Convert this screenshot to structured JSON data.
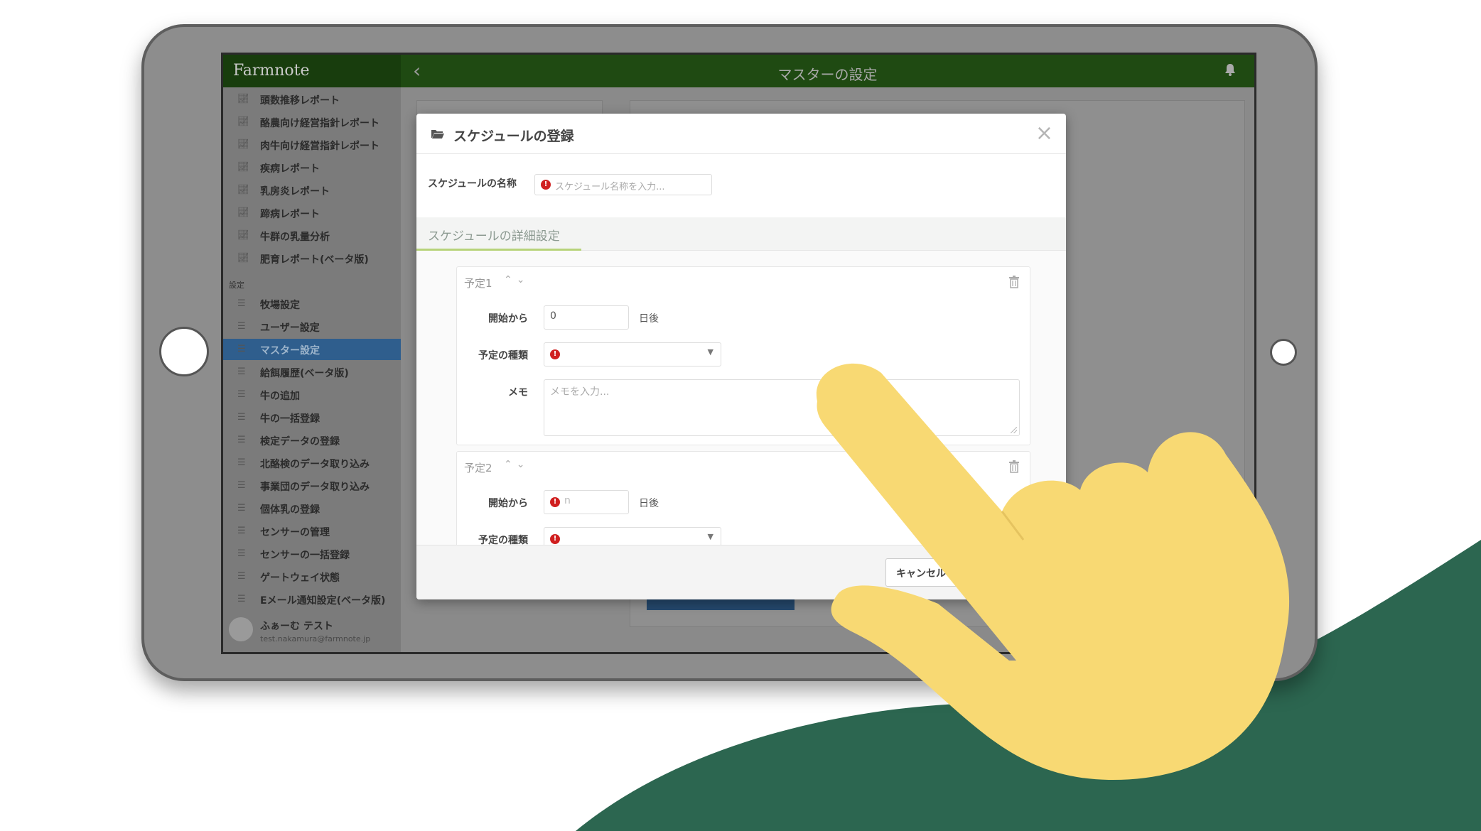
{
  "app": {
    "logo": "Farmnote",
    "page_title": "マスターの設定"
  },
  "sidebar": {
    "report_items": [
      {
        "label": "頭数推移レポート"
      },
      {
        "label": "酪農向け経営指針レポート"
      },
      {
        "label": "肉牛向け経営指針レポート"
      },
      {
        "label": "疾病レポート"
      },
      {
        "label": "乳房炎レポート"
      },
      {
        "label": "蹄病レポート"
      },
      {
        "label": "牛群の乳量分析"
      },
      {
        "label": "肥育レポート(ベータ版)"
      }
    ],
    "section_label": "設定",
    "settings_items": [
      {
        "label": "牧場設定"
      },
      {
        "label": "ユーザー設定"
      },
      {
        "label": "マスター設定",
        "active": true
      },
      {
        "label": "給餌履歴(ベータ版)"
      },
      {
        "label": "牛の追加"
      },
      {
        "label": "牛の一括登録"
      },
      {
        "label": "検定データの登録"
      },
      {
        "label": "北酪検のデータ取り込み"
      },
      {
        "label": "事業団のデータ取り込み"
      },
      {
        "label": "個体乳の登録"
      },
      {
        "label": "センサーの管理"
      },
      {
        "label": "センサーの一括登録"
      },
      {
        "label": "ゲートウェイ状態"
      },
      {
        "label": "Eメール通知設定(ベータ版)"
      }
    ],
    "user": {
      "name": "ふぁーむ テスト",
      "email": "test.nakamura@farmnote.jp"
    }
  },
  "modal": {
    "title": "スケジュールの登録",
    "name_label": "スケジュールの名称",
    "name_placeholder": "スケジュール名称を入力...",
    "section_tab": "スケジュールの詳細設定",
    "schedules": [
      {
        "title": "予定1",
        "start_label": "開始から",
        "start_value": "0",
        "days_after": "日後",
        "type_label": "予定の種類",
        "memo_label": "メモ",
        "memo_placeholder": "メモを入力..."
      },
      {
        "title": "予定2",
        "start_label": "開始から",
        "start_value": "n",
        "days_after": "日後",
        "type_label": "予定の種類"
      }
    ],
    "cancel_label": "キャンセル"
  },
  "colors": {
    "brand_green": "#2c6650",
    "hand_yellow": "#f8d973",
    "active_blue": "#2f5e8d",
    "error_red": "#d01f1f"
  }
}
